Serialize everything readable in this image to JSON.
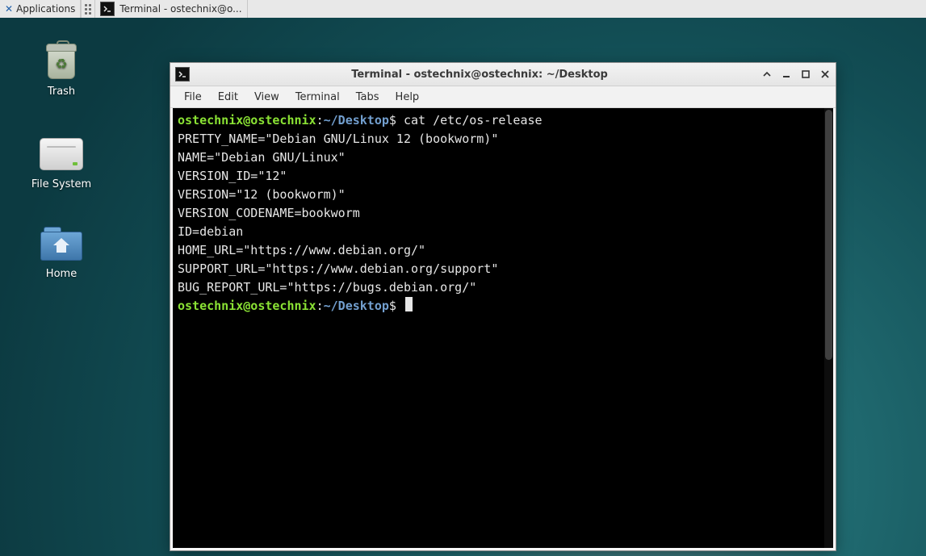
{
  "panel": {
    "applications_label": "Applications",
    "task_label": "Terminal - ostechnix@o..."
  },
  "desktop_icons": {
    "trash": "Trash",
    "filesystem": "File System",
    "home": "Home"
  },
  "window": {
    "title": "Terminal - ostechnix@ostechnix: ~/Desktop",
    "menu": {
      "file": "File",
      "edit": "Edit",
      "view": "View",
      "terminal": "Terminal",
      "tabs": "Tabs",
      "help": "Help"
    }
  },
  "terminal": {
    "prompt_user": "ostechnix@ostechnix",
    "prompt_sep": ":",
    "prompt_path": "~/Desktop",
    "prompt_end": "$ ",
    "command": "cat /etc/os-release",
    "output": [
      "PRETTY_NAME=\"Debian GNU/Linux 12 (bookworm)\"",
      "NAME=\"Debian GNU/Linux\"",
      "VERSION_ID=\"12\"",
      "VERSION=\"12 (bookworm)\"",
      "VERSION_CODENAME=bookworm",
      "ID=debian",
      "HOME_URL=\"https://www.debian.org/\"",
      "SUPPORT_URL=\"https://www.debian.org/support\"",
      "BUG_REPORT_URL=\"https://bugs.debian.org/\""
    ]
  }
}
